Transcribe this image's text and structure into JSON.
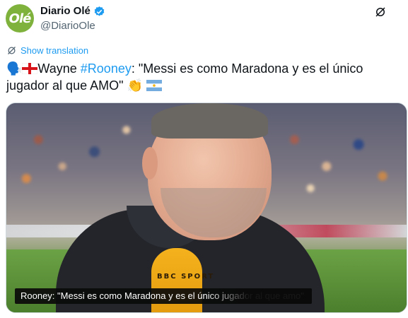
{
  "author": {
    "display_name": "Diario Olé",
    "handle": "@DiarioOle",
    "avatar_text": "Olé",
    "verified_icon": "verified-badge-icon",
    "brand_color": "#7fb23c"
  },
  "more_icon": "grok-slash-icon",
  "translate": {
    "icon": "globe-icon",
    "label": "Show translation"
  },
  "tweet": {
    "prefix_emoji": "🗣️",
    "word_before": "Wayne ",
    "hashtag": "#Rooney",
    "text_after": ": \"Messi es como Maradona y es el único jugador al que AMO\" ",
    "suffix_emoji": "👏"
  },
  "media": {
    "caption": "Rooney: \"Messi es como Maradona y es el único jugador al que amo\"",
    "mic_text": "BBC SPORT"
  },
  "colors": {
    "link": "#1d9bf0",
    "secondary_text": "#536471"
  }
}
